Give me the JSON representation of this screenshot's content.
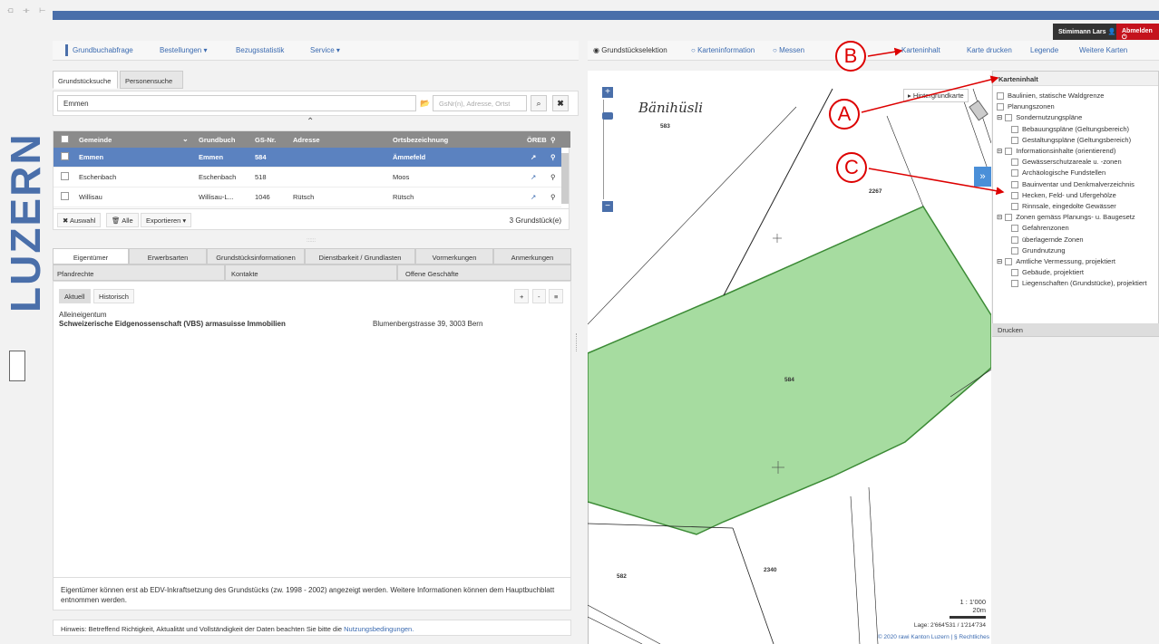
{
  "topbar": {
    "icons": "⟤ ⟛ ⊢",
    "user": "Stimimann Lars",
    "logout": "Abmelden"
  },
  "logo": {
    "text": "LUZERN"
  },
  "nav_left": [
    "Grundbuchabfrage",
    "Bestellungen ▾",
    "Bezugsstatistik",
    "Service ▾"
  ],
  "tabs": [
    "Grundstücksuche",
    "Personensuche"
  ],
  "search": {
    "value": "Emmen",
    "placeholder": "GsNr(n), Adresse, Ortst"
  },
  "grid": {
    "headers": [
      "Gemeinde",
      "Grundbuch",
      "GS-Nr.",
      "Adresse",
      "Ortsbezeichnung",
      "ÖREB"
    ],
    "rows": [
      [
        "Emmen",
        "Emmen",
        "584",
        "",
        "Ämmefeld"
      ],
      [
        "Eschenbach",
        "Eschenbach",
        "518",
        "",
        "Moos"
      ],
      [
        "Willisau",
        "Willisau-L...",
        "1046",
        "Rütsch",
        "Rütsch"
      ]
    ],
    "buttons": [
      "✖ Auswahl",
      "🗑 Alle",
      "Exportieren ▾"
    ],
    "count": "3 Grundstück(e)"
  },
  "tabs2_row1": [
    "Eigentümer",
    "Erwerbsarten",
    "Grundstücksinformationen",
    "Dienstbarkeit / Grundlasten",
    "Vormerkungen",
    "Anmerkungen"
  ],
  "tabs2_row2": [
    "Pfandrechte",
    "Kontakte",
    "Offene Geschäfte"
  ],
  "detail": {
    "subtabs": [
      "Aktuell",
      "Historisch"
    ],
    "type": "Alleineigentum",
    "owner": "Schweizerische Eidgenossenschaft (VBS) armasuisse Immobilien",
    "address": "Blumenbergstrasse 39, 3003 Bern",
    "note": "Eigentümer können erst ab EDV-Inkraftsetzung des Grundstücks (zw. 1998 - 2002) angezeigt werden. Weitere Informationen können dem Hauptbuchblatt entnommen werden."
  },
  "hint": {
    "text": "Hinweis: Betreffend Richtigkeit, Aktualität und Vollständigkeit der Daten beachten Sie bitte die ",
    "link": "Nutzungsbedingungen."
  },
  "map_nav": [
    "Grundstückselektion",
    "Karteninformation",
    "Messen",
    "Karteninhalt",
    "Karte drucken",
    "Legende",
    "Weitere Karten"
  ],
  "map": {
    "place": "Bänihüsli",
    "labels": [
      "583",
      "2267",
      "584",
      "2340",
      "582"
    ],
    "background_btn": "▸ Hintergrundkarte",
    "scale": "1 : 1'000",
    "scalebar": "20m",
    "coords": "Lage: 2'664'531 / 1'214'734",
    "copyright": "© 2020 rawi Kanton Luzern | § Rechtliches"
  },
  "karteninhalt": {
    "title": "Karteninhalt",
    "items": [
      {
        "label": "Baulinien, statische Waldgrenze",
        "level": 0
      },
      {
        "label": "Planungszonen",
        "level": 0
      },
      {
        "label": "Sondernutzungspläne",
        "level": 0,
        "group": true
      },
      {
        "label": "Bebauungspläne (Geltungsbereich)",
        "level": 1
      },
      {
        "label": "Gestaltungspläne (Geltungsbereich)",
        "level": 1
      },
      {
        "label": "Informationsinhalte (orientierend)",
        "level": 0,
        "group": true
      },
      {
        "label": "Gewässerschutzareale u. -zonen",
        "level": 1
      },
      {
        "label": "Archäologische Fundstellen",
        "level": 1
      },
      {
        "label": "Bauinventar und Denkmalverzeichnis",
        "level": 1
      },
      {
        "label": "Hecken, Feld- und Ufergehölze",
        "level": 1
      },
      {
        "label": "Rinnsale, eingedolte Gewässer",
        "level": 1
      },
      {
        "label": "Zonen gemäss Planungs- u. Baugesetz",
        "level": 0,
        "group": true
      },
      {
        "label": "Gefahrenzonen",
        "level": 1
      },
      {
        "label": "überlagernde Zonen",
        "level": 1
      },
      {
        "label": "Grundnutzung",
        "level": 1
      },
      {
        "label": "Amtliche Vermessung, projektiert",
        "level": 0,
        "group": true
      },
      {
        "label": "Gebäude, projektiert",
        "level": 1
      },
      {
        "label": "Liegenschaften (Grundstücke), projektiert",
        "level": 1
      }
    ],
    "drucken": "Drucken"
  },
  "callouts": [
    "A",
    "B",
    "C"
  ],
  "colors": {
    "accent": "#4a6faa",
    "selected": "#5b82c0",
    "parcel": "#a6dca0",
    "logout": "#c4121c",
    "callout": "#dd0000"
  }
}
